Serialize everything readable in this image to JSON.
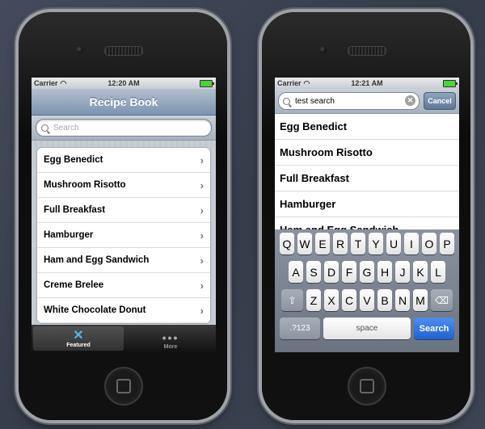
{
  "left": {
    "status": {
      "carrier": "Carrier",
      "time": "12:20 AM"
    },
    "title": "Recipe Book",
    "search_placeholder": "Search",
    "items": [
      "Egg Benedict",
      "Mushroom Risotto",
      "Full Breakfast",
      "Hamburger",
      "Ham and Egg Sandwich",
      "Creme Brelee",
      "White Chocolate Donut"
    ],
    "tabs": [
      {
        "label": "Featured",
        "icon": "featured-icon"
      },
      {
        "label": "More",
        "icon": "more-icon"
      }
    ]
  },
  "right": {
    "status": {
      "carrier": "Carrier",
      "time": "12:21 AM"
    },
    "search_value": "test search",
    "cancel_label": "Cancel",
    "items": [
      "Egg Benedict",
      "Mushroom Risotto",
      "Full Breakfast",
      "Hamburger",
      "Ham and Egg Sandwich"
    ],
    "keyboard": {
      "row1": [
        "Q",
        "W",
        "E",
        "R",
        "T",
        "Y",
        "U",
        "I",
        "O",
        "P"
      ],
      "row2": [
        "A",
        "S",
        "D",
        "F",
        "G",
        "H",
        "J",
        "K",
        "L"
      ],
      "row3": [
        "Z",
        "X",
        "C",
        "V",
        "B",
        "N",
        "M"
      ],
      "numbers_label": ".?123",
      "space_label": "space",
      "search_label": "Search"
    }
  },
  "colors": {
    "accent": "#4fb7e9",
    "search_key": "#1e63d6",
    "battery": "#4cd33a"
  }
}
